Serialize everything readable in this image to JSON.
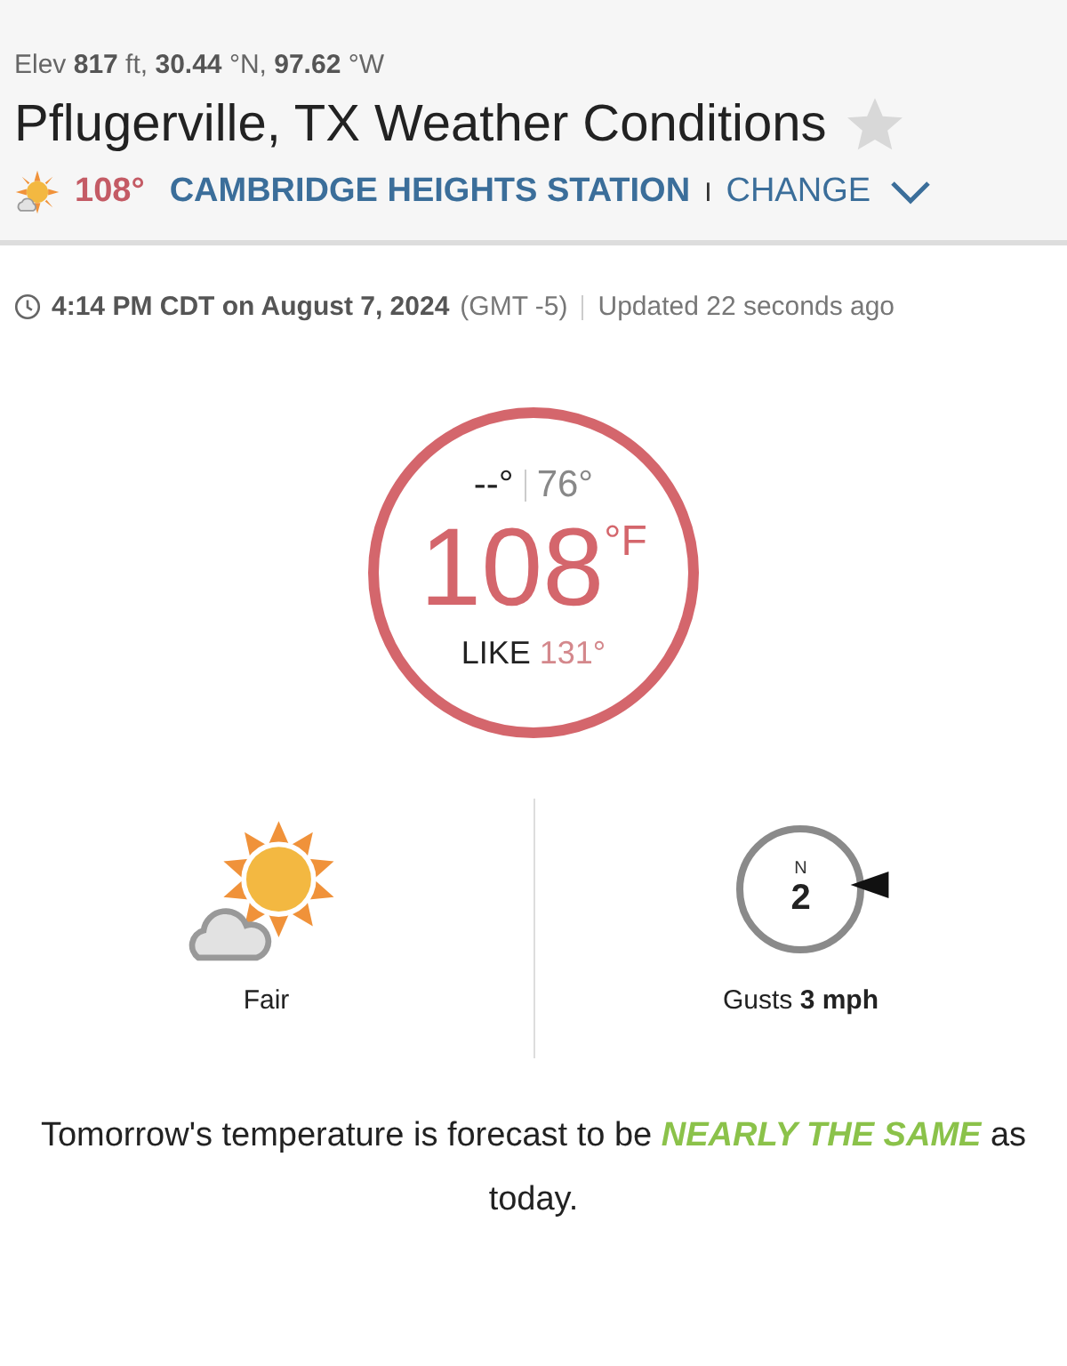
{
  "header": {
    "elevation": "Elev **817** ft, **30.44** °N, **97.62** °W",
    "title": "Pflugerville, TX Weather Conditions",
    "temperature": "108°",
    "station": "CAMBRIDGE HEIGHTS STATION",
    "separator": "I",
    "change": "CHANGE"
  },
  "observation": {
    "time": "4:14 PM CDT on August 7, 2024",
    "timezone": "(GMT -5)",
    "updated": "Updated 22 seconds ago"
  },
  "current": {
    "high": "--°",
    "low": "76°",
    "temperature": "108",
    "unit": "°F",
    "feels_label": "LIKE",
    "feels_value": "131°"
  },
  "condition": {
    "label": "Fair"
  },
  "wind": {
    "north": "N",
    "speed": "2",
    "gusts": "Gusts **3 mph**"
  },
  "forecast": {
    "text": "Tomorrow's temperature is forecast to be",
    "emphasis": "NEARLY THE SAME",
    "suffix": "as today."
  }
}
